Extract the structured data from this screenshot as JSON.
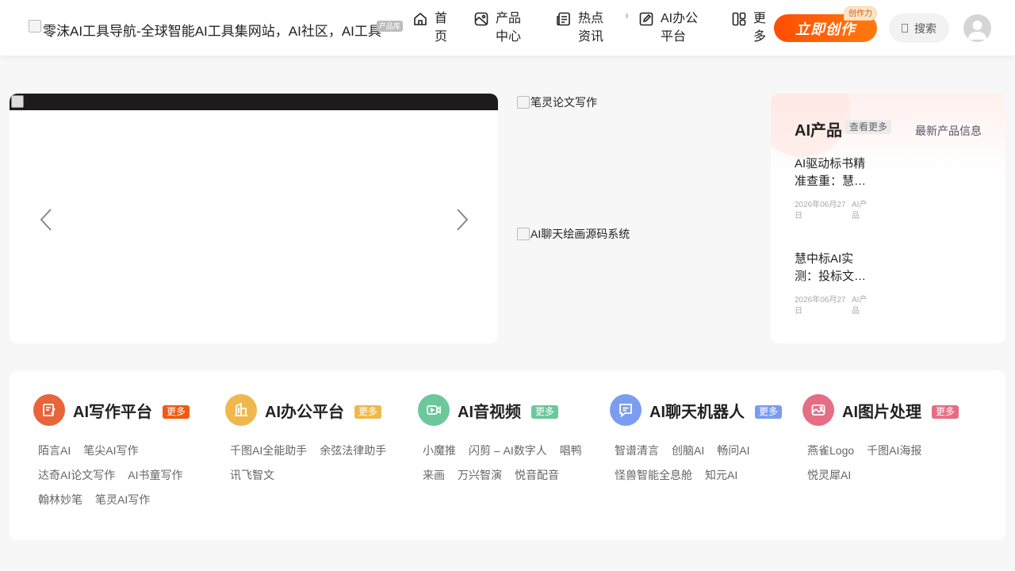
{
  "header": {
    "logo_alt": "零沫AI工具导航-全球智能AI工具集网站，AI社区，AI工具",
    "logo_tag": "产品库",
    "nav": [
      {
        "line1": "首",
        "line2": "页",
        "icon": "home-icon"
      },
      {
        "line1": "产品",
        "line2": "中心",
        "icon": "product-center-icon"
      },
      {
        "line1": "热点",
        "line2": "资讯",
        "icon": "news-icon"
      },
      {
        "line1": "AI办公",
        "line2": "平台",
        "icon": "edit-icon"
      },
      {
        "line1": "更",
        "line2": "多",
        "icon": "grid-more-icon"
      }
    ],
    "create_label": "立即创作",
    "create_badge": "创作力",
    "search_label": "搜索",
    "accent_color": "#ff5a00"
  },
  "banner": {
    "side_images": [
      "笔灵论文写作",
      "AI聊天绘画源码系统"
    ]
  },
  "products": {
    "title": "AI产品",
    "more": "查看更多",
    "latest": "最新产品信息",
    "items": [
      {
        "title": "AI驱动标书精准查重：慧…",
        "date": "2026年06月27日",
        "category": "AI产品"
      },
      {
        "title": "慧中标AI实测：投标文…",
        "date": "2026年06月27日",
        "category": "AI产品"
      }
    ]
  },
  "categories": [
    {
      "name": "AI写作平台",
      "more": "更多",
      "color": "#e8643a",
      "badge_color": "#f25a14",
      "icon": "writing-icon",
      "links": [
        "陌言AI",
        "笔尖AI写作",
        "达奇AI论文写作",
        "AI书童写作",
        "翰林妙笔",
        "笔灵AI写作"
      ]
    },
    {
      "name": "AI办公平台",
      "more": "更多",
      "color": "#f0b84c",
      "badge_color": "#f0b84c",
      "icon": "office-building-icon",
      "links": [
        "千图AI全能助手",
        "余弦法律助手",
        "讯飞智文"
      ]
    },
    {
      "name": "AI音视频",
      "more": "更多",
      "color": "#6cc79c",
      "badge_color": "#6cc79c",
      "icon": "video-icon",
      "links": [
        "小魔推",
        "闪剪 – AI数字人",
        "唱鸭",
        "来画",
        "万兴智演",
        "悦音配音"
      ]
    },
    {
      "name": "AI聊天机器人",
      "more": "更多",
      "color": "#7a9df0",
      "badge_color": "#7a9df0",
      "icon": "chat-icon",
      "links": [
        "智谱清言",
        "创脑AI",
        "畅问AI",
        "怪兽智能全息舱",
        "知元AI"
      ]
    },
    {
      "name": "AI图片处理",
      "more": "更多",
      "color": "#e66e84",
      "badge_color": "#e66e84",
      "icon": "image-icon",
      "links": [
        "燕雀Logo",
        "千图AI海报",
        "悦灵犀AI"
      ]
    }
  ]
}
